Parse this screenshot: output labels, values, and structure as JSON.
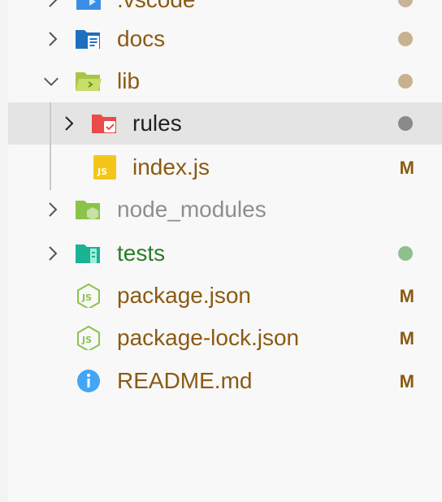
{
  "explorer": {
    "items": [
      {
        "label": ".vscode",
        "status": "",
        "dot_color": "#c5b49a"
      },
      {
        "label": "docs",
        "status": "",
        "dot_color": "#c8b28e"
      },
      {
        "label": "lib",
        "status": "",
        "dot_color": "#c8b28e"
      },
      {
        "label": "rules",
        "status": "",
        "dot_color": "#8a8a8a"
      },
      {
        "label": "index.js",
        "status": "M"
      },
      {
        "label": "node_modules",
        "status": ""
      },
      {
        "label": "tests",
        "status": "",
        "dot_color": "#8fbf8f"
      },
      {
        "label": "package.json",
        "status": "M"
      },
      {
        "label": "package-lock.json",
        "status": "M"
      },
      {
        "label": "README.md",
        "status": "M"
      }
    ]
  },
  "colors": {
    "modified": "#8b5a12",
    "untracked": "#2a7d2a",
    "ignored": "#8e8e8e",
    "selected_row": "#e4e4e4"
  }
}
